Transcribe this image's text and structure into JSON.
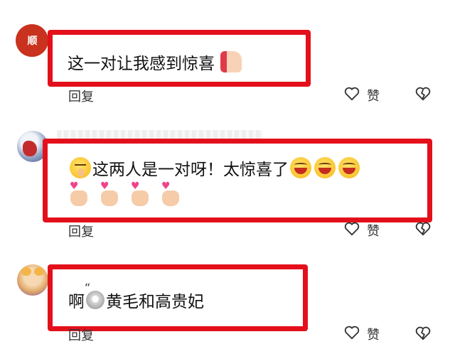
{
  "comments": [
    {
      "avatar_seal_text": "顺",
      "text": "这一对让我感到惊喜",
      "emojis": [
        "thumbs-up-icon"
      ],
      "reply_label": "回复",
      "like_label": "赞"
    },
    {
      "text_part1": "这两人是一对呀！太惊喜了",
      "emojis": [
        "shushing-face-icon",
        "laughing-face-icon",
        "laughing-face-icon",
        "laughing-face-icon",
        "finger-heart-icon",
        "finger-heart-icon",
        "finger-heart-icon",
        "finger-heart-icon"
      ],
      "reply_label": "回复",
      "like_label": "赞"
    },
    {
      "text_part1": "啊",
      "text_part2": "黄毛和高贵妃",
      "emojis": [
        "dizzy-face-icon"
      ],
      "reply_label": "回复",
      "like_label": "赞"
    }
  ],
  "colors": {
    "highlight_frame": "#e3101c"
  }
}
